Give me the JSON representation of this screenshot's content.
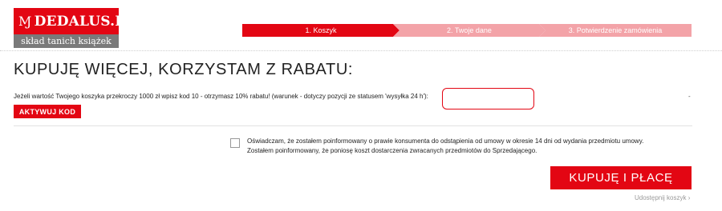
{
  "logo": {
    "brand": "DEDALUS.PL",
    "swirl_glyph": "Ɱ",
    "tagline": "skład tanich książek"
  },
  "steps": [
    {
      "label": "1. Koszyk",
      "active": true
    },
    {
      "label": "2. Twoje dane",
      "active": false
    },
    {
      "label": "3. Potwierdzenie zamówienia",
      "active": false
    }
  ],
  "main": {
    "title": "KUPUJĘ WIĘCEJ, KORZYSTAM Z RABATU:",
    "promo_text": "Jeżeli wartość Twojego koszyka przekroczy 1000 zł wpisz kod 10 - otrzymasz 10% rabatu! (warunek - dotyczy pozycji ze statusem 'wysyłka 24 h'):",
    "promo_input_value": "",
    "promo_input_placeholder": "",
    "dash": "-",
    "activate_label": "AKTYWUJ KOD"
  },
  "consent": {
    "line1": "Oświadczam, że zostałem poinformowany o prawie konsumenta do odstąpienia od umowy w okresie 14 dni od wydania przedmiotu umowy.",
    "line2": "Zostałem poinformowany, że poniosę koszt dostarczenia zwracanych przedmiotów do Sprzedającego.",
    "checked": false
  },
  "actions": {
    "buy_label": "KUPUJĘ I PŁACĘ",
    "share_label": "Udostępnij koszyk ›"
  },
  "colors": {
    "accent": "#e30613",
    "step_inactive": "#f3a3a8",
    "logo_gray": "#7a7a7a"
  }
}
